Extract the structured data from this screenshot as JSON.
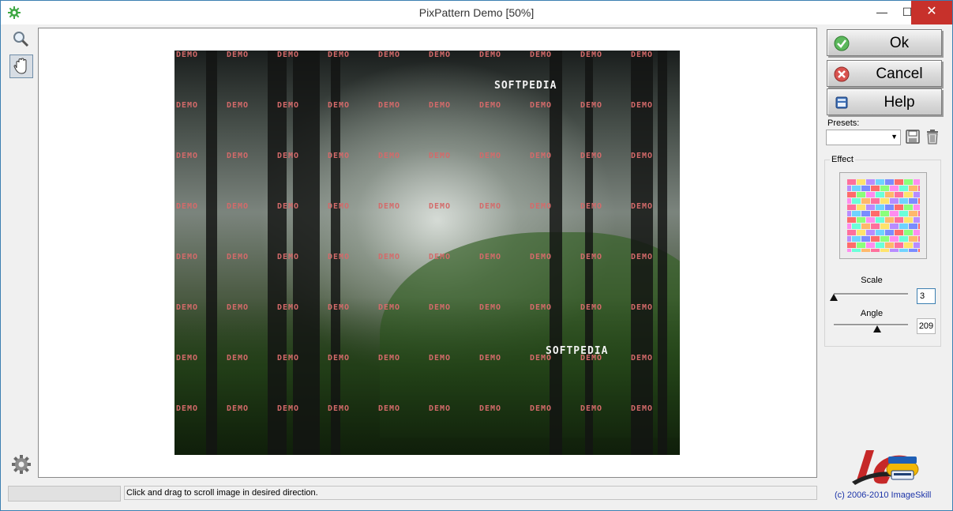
{
  "window": {
    "title": "PixPattern Demo [50%]",
    "min_glyph": "—",
    "max_glyph": "☐",
    "close_glyph": "✕"
  },
  "toolbar": {
    "tools": [
      "zoom-icon",
      "hand-icon"
    ],
    "settings": "gear-icon"
  },
  "image": {
    "watermark": "DEMO",
    "logo_text": "SOFTPEDIA"
  },
  "status": {
    "text": "Click and drag to scroll image in desired direction."
  },
  "buttons": {
    "ok": "Ok",
    "cancel": "Cancel",
    "help": "Help"
  },
  "presets": {
    "label": "Presets:",
    "value": ""
  },
  "effect": {
    "label": "Effect",
    "scale_label": "Scale",
    "scale_value": "3",
    "scale_slider": 0.0,
    "angle_label": "Angle",
    "angle_value": "209",
    "angle_slider": 0.58
  },
  "footer": {
    "copyright": "(c) 2006-2010 ImageSkill"
  },
  "colors": {
    "accent": "#3c7fb1",
    "close": "#c7312b",
    "watermark": "#d46a6a",
    "link": "#1b33a8"
  }
}
